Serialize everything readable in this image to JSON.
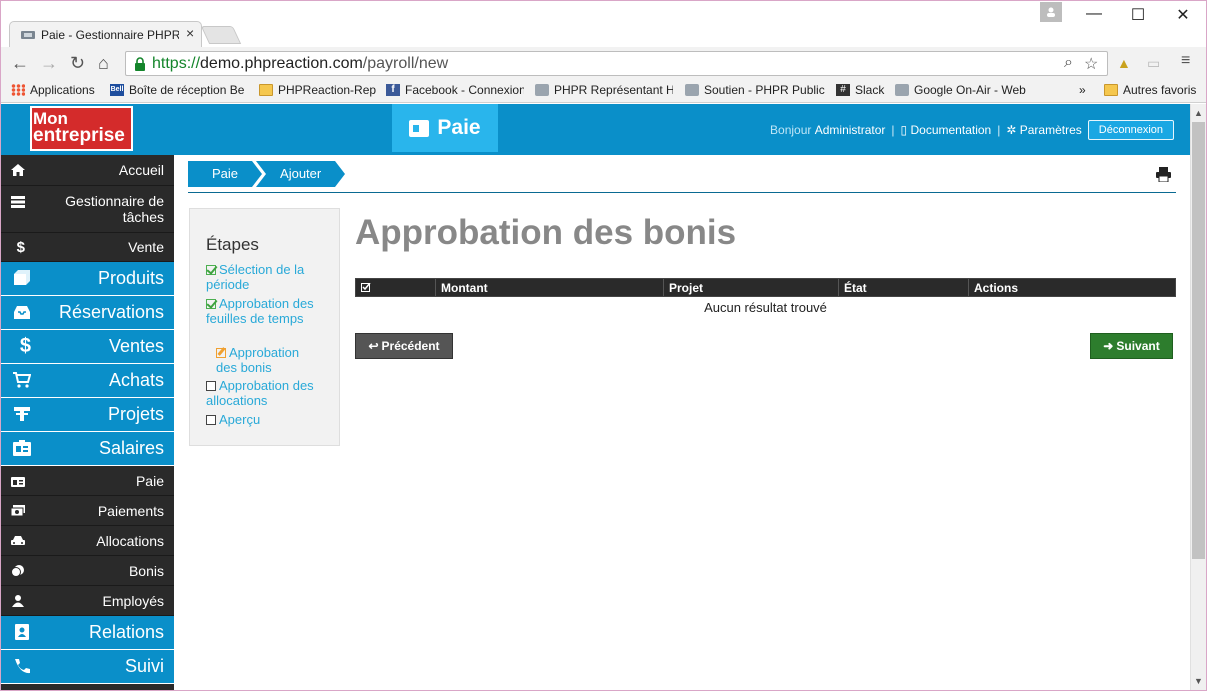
{
  "browser": {
    "tab_title": "Paie - Gestionnaire PHPRe",
    "tab_close": "×",
    "url_scheme": "https://",
    "url_host": "demo.phpreaction.com",
    "url_path": "/payroll/new",
    "bookmarks": [
      {
        "label": "Applications",
        "icon": "apps-icon"
      },
      {
        "label": "Boîte de réception Be",
        "icon": "bell-icon"
      },
      {
        "label": "PHPReaction-Rep",
        "icon": "folder-icon"
      },
      {
        "label": "Facebook - Connexion",
        "icon": "facebook-icon"
      },
      {
        "label": "PHPR Représentant H",
        "icon": "phpr-icon"
      },
      {
        "label": "Soutien - PHPR Public",
        "icon": "phpr-icon"
      },
      {
        "label": "Slack",
        "icon": "slack-icon"
      },
      {
        "label": "Google On-Air - Web",
        "icon": "phpr-icon"
      },
      {
        "label": "»",
        "icon": ""
      },
      {
        "label": "Autres favoris",
        "icon": "folder-icon"
      }
    ]
  },
  "header": {
    "logo_line1": "Mon",
    "logo_line2": "entreprise",
    "module": "Paie",
    "greeting": "Bonjour",
    "user": "Administrator",
    "documentation": "Documentation",
    "settings": "Paramètres",
    "logout": "Déconnexion"
  },
  "sidebar": {
    "items": [
      {
        "label": "Accueil",
        "type": "small",
        "icon": "home-icon"
      },
      {
        "label": "Gestionnaire de tâches",
        "type": "small",
        "icon": "tasks-icon"
      },
      {
        "label": "Vente",
        "type": "small",
        "icon": "dollar-icon"
      },
      {
        "label": "Produits",
        "type": "big",
        "icon": "box-icon"
      },
      {
        "label": "Réservations",
        "type": "big",
        "icon": "inbox-icon"
      },
      {
        "label": "Ventes",
        "type": "big",
        "icon": "dollar-icon"
      },
      {
        "label": "Achats",
        "type": "big",
        "icon": "cart-icon"
      },
      {
        "label": "Projets",
        "type": "big",
        "icon": "tools-icon"
      },
      {
        "label": "Salaires",
        "type": "big",
        "icon": "id-card-icon"
      },
      {
        "label": "Paie",
        "type": "small",
        "icon": "id-card-icon"
      },
      {
        "label": "Paiements",
        "type": "small",
        "icon": "money-icon"
      },
      {
        "label": "Allocations",
        "type": "small",
        "icon": "car-icon"
      },
      {
        "label": "Bonis",
        "type": "small",
        "icon": "coins-icon"
      },
      {
        "label": "Employés",
        "type": "small",
        "icon": "user-icon"
      },
      {
        "label": "Relations",
        "type": "big",
        "icon": "contact-icon"
      },
      {
        "label": "Suivi",
        "type": "big",
        "icon": "phone-icon"
      }
    ]
  },
  "breadcrumb": [
    "Paie",
    "Ajouter"
  ],
  "steps": {
    "title": "Étapes",
    "items": [
      {
        "label": "Sélection de la période",
        "state": "done"
      },
      {
        "label": "Approbation des feuilles de temps",
        "state": "done"
      },
      {
        "label": "Approbation des bonis",
        "state": "current"
      },
      {
        "label": "Approbation des allocations",
        "state": "todo"
      },
      {
        "label": "Aperçu",
        "state": "todo"
      }
    ]
  },
  "main": {
    "title": "Approbation des bonis",
    "columns": [
      "",
      "Montant",
      "Projet",
      "État",
      "Actions"
    ],
    "empty_message": "Aucun résultat trouvé",
    "prev_label": "Précédent",
    "next_label": "Suivant"
  },
  "colors": {
    "primary": "#0a8fc9",
    "sidebar_dark": "#2a2a2a",
    "accent_light": "#29b5ec",
    "logo_red": "#d42b2b",
    "success": "#2d7d2d",
    "link": "#29a9d8"
  }
}
